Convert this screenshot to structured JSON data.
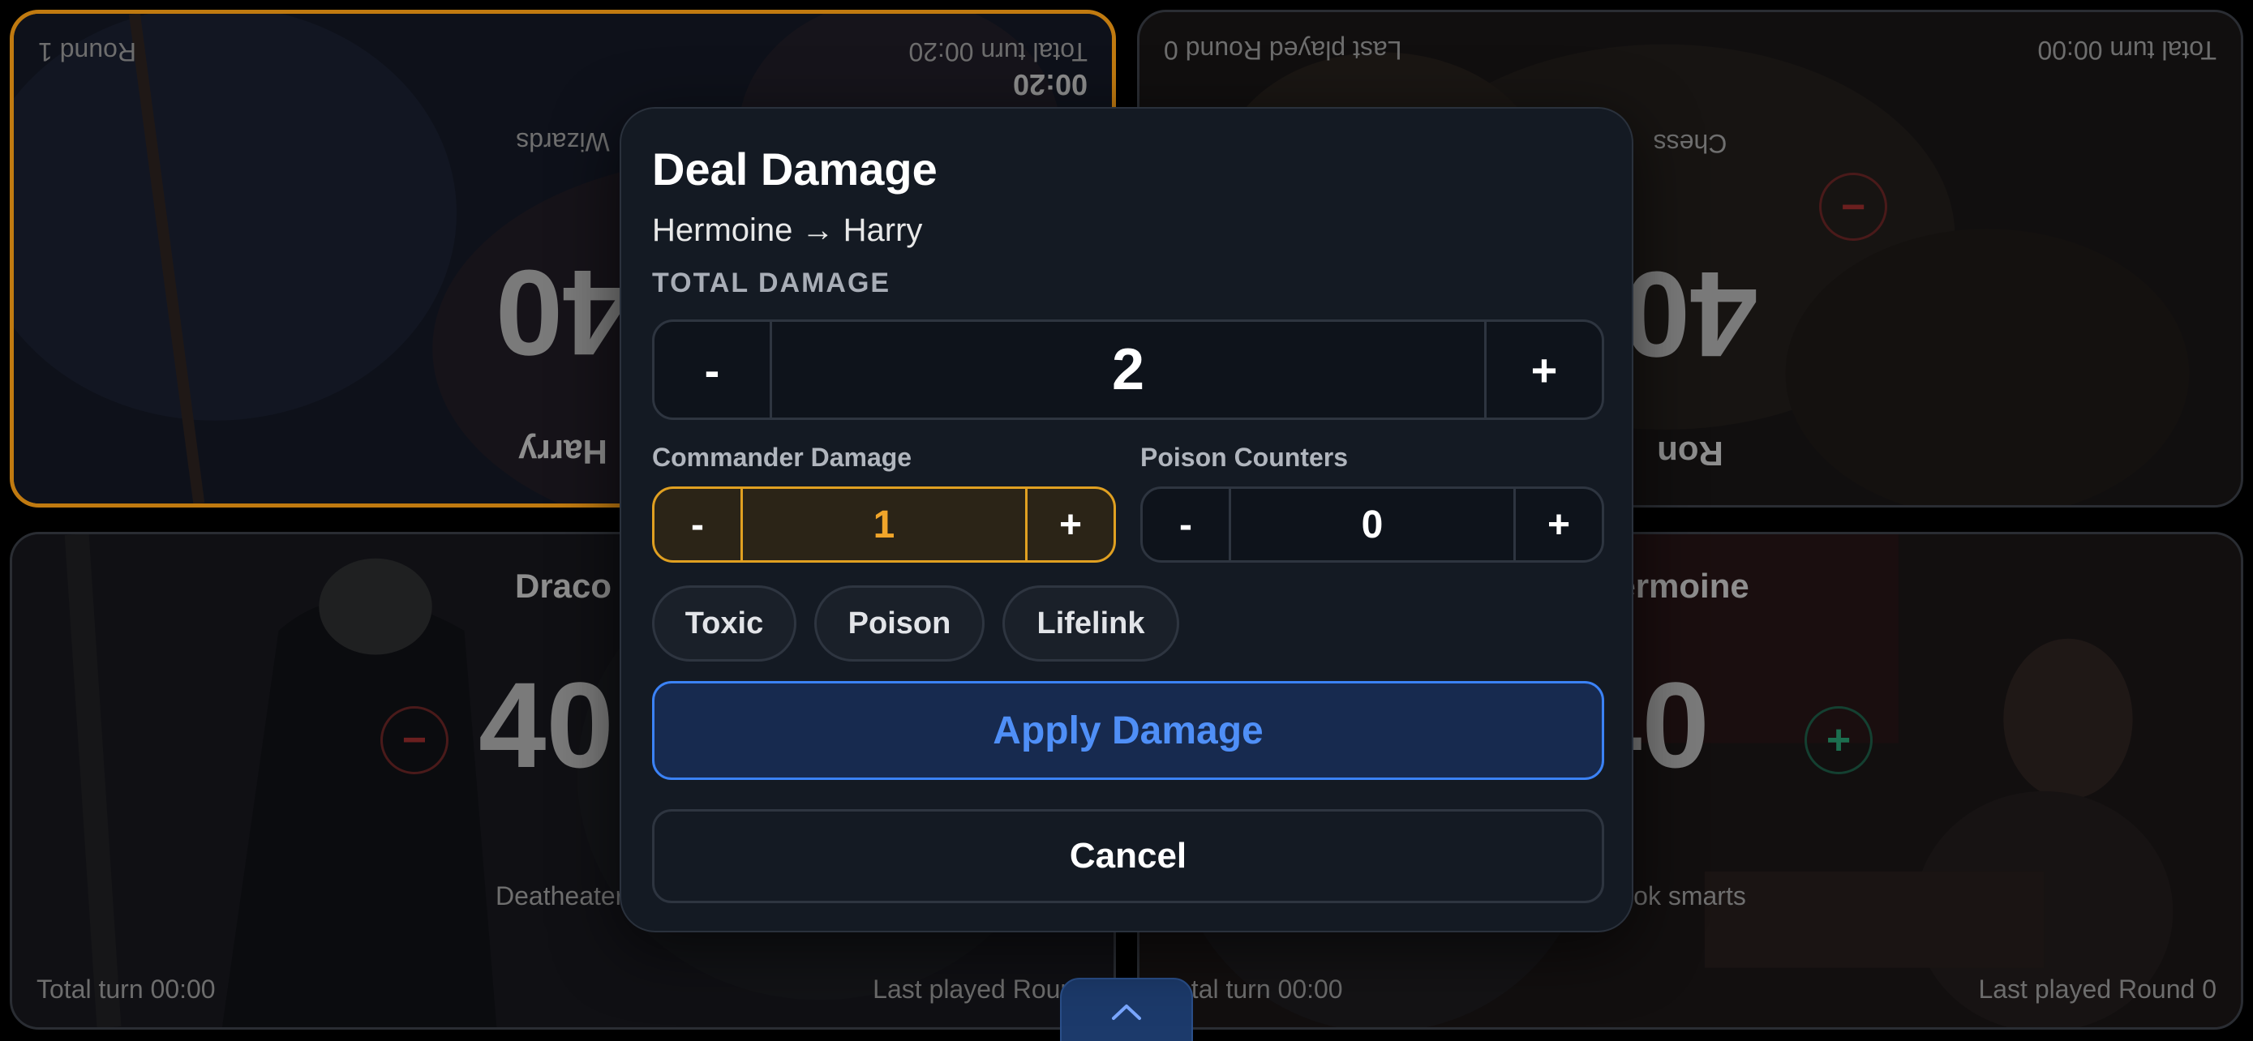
{
  "players": {
    "harry": {
      "name": "Harry",
      "life": "40",
      "subtitle": "Wizards",
      "round": "Round 1",
      "total_turn": "Total turn 00:20",
      "turn_timer": "00:20"
    },
    "ron": {
      "name": "Ron",
      "life": "40",
      "subtitle": "Chess",
      "round": "Last played Round 0",
      "total_turn": "Total turn 00:00"
    },
    "draco": {
      "name": "Draco",
      "life": "40",
      "subtitle": "Deatheater",
      "round": "Last played Round",
      "total_turn": "Total turn 00:00"
    },
    "hermoine": {
      "name": "Hermoine",
      "life": "40",
      "subtitle": "Book smarts",
      "round": "Last played Round 0",
      "total_turn": "Total turn 00:00"
    }
  },
  "modal": {
    "title": "Deal Damage",
    "subtitle": "Hermoine → Harry",
    "total_label": "TOTAL DAMAGE",
    "total_value": "2",
    "minus": "-",
    "plus": "+",
    "commander_label": "Commander Damage",
    "commander_value": "1",
    "poison_label": "Poison Counters",
    "poison_value": "0",
    "chips": [
      "Toxic",
      "Poison",
      "Lifelink"
    ],
    "apply_label": "Apply Damage",
    "cancel_label": "Cancel"
  },
  "colors": {
    "active_border": "#c07a10",
    "accent_blue": "#3b82f6",
    "commander_orange": "#f0a52a"
  }
}
